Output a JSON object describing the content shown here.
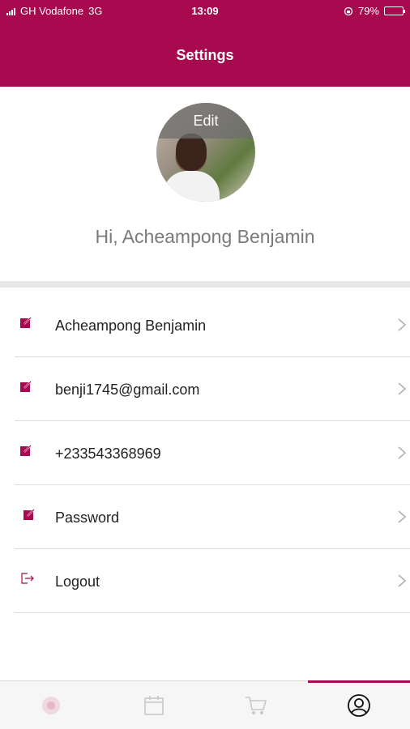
{
  "status": {
    "carrier": "GH Vodafone",
    "network": "3G",
    "time": "13:09",
    "battery_percent": "79%",
    "battery_level": 0.79
  },
  "header": {
    "title": "Settings"
  },
  "profile": {
    "edit_label": "Edit",
    "greeting": "Hi, Acheampong Benjamin"
  },
  "settings": {
    "items": [
      {
        "label": "Acheampong Benjamin",
        "icon": "edit-icon"
      },
      {
        "label": "benji1745@gmail.com",
        "icon": "edit-icon"
      },
      {
        "label": "+233543368969",
        "icon": "edit-icon"
      },
      {
        "label": "Password",
        "icon": "edit-icon"
      },
      {
        "label": "Logout",
        "icon": "logout-icon"
      }
    ]
  },
  "tabbar": {
    "tabs": [
      {
        "icon": "home-logo-icon",
        "active": false
      },
      {
        "icon": "calendar-icon",
        "active": false
      },
      {
        "icon": "cart-icon",
        "active": false
      },
      {
        "icon": "profile-icon",
        "active": true
      }
    ]
  },
  "colors": {
    "brand": "#a80a4f",
    "divider": "#dddddd",
    "tab_inactive": "#c8c8c8"
  }
}
